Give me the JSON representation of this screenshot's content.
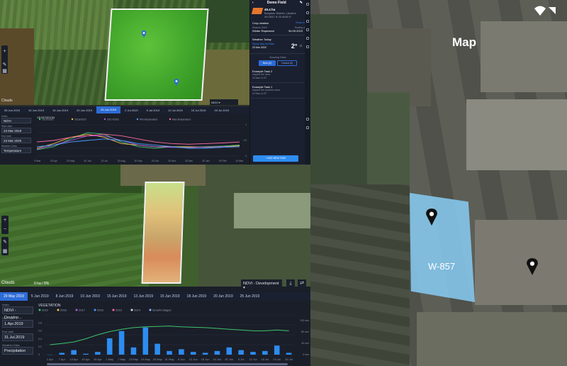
{
  "panel1": {
    "clouds_label": "Clouds",
    "layer_select": "NDVI",
    "dates": [
      "05 Jun 2019",
      "10 Jun 2019",
      "15 Jun 2019",
      "20 Jun 2019",
      "25 Jun 2019",
      "2 Jul 2019",
      "5 Jul 2019",
      "10 Jul 2019",
      "15 Jul 2019",
      "20 Jul 2019"
    ],
    "active_date_index": 4,
    "tools": [
      {
        "label": "Index",
        "value": "NDVI"
      },
      {
        "label": "Start date",
        "value": "23 Mar 2019"
      },
      {
        "label": "End date",
        "value": "23 Mar 2020"
      },
      {
        "label": "Weather Data",
        "value": "Temperature"
      }
    ],
    "vegetation_title": "VEGETATION",
    "chart_data": {
      "type": "line",
      "x": [
        "20 Mar",
        "20 Apr",
        "20 May",
        "20 Jun",
        "20 Jul",
        "20 Aug",
        "20 Sep",
        "20 Oct",
        "20 Nov",
        "20 Dec",
        "20 Jan",
        "20 Feb",
        "20 Mar"
      ],
      "series": [
        {
          "name": "2019/2020",
          "values": [
            0.2,
            0.3,
            0.55,
            0.75,
            0.7,
            0.45,
            0.3,
            0.25,
            0.3,
            0.28,
            0.3,
            0.32,
            0.35
          ]
        },
        {
          "name": "2018/2019",
          "values": [
            0.25,
            0.4,
            0.6,
            0.7,
            0.6,
            0.4,
            0.35,
            0.3,
            0.3,
            0.3,
            0.28,
            0.3,
            0.33
          ]
        },
        {
          "name": "2017/2018",
          "values": [
            0.22,
            0.35,
            0.5,
            0.65,
            0.65,
            0.5,
            0.35,
            0.3,
            0.28,
            0.27,
            0.29,
            0.3,
            0.3
          ]
        },
        {
          "name": "Min temperature",
          "values": [
            0.3,
            0.35,
            0.45,
            0.5,
            0.55,
            0.5,
            0.4,
            0.35,
            0.3,
            0.25,
            0.25,
            0.28,
            0.3
          ]
        },
        {
          "name": "Max temperature",
          "values": [
            0.45,
            0.5,
            0.6,
            0.65,
            0.7,
            0.65,
            0.55,
            0.45,
            0.4,
            0.38,
            0.4,
            0.42,
            0.45
          ]
        }
      ],
      "ylim": [
        0,
        1
      ]
    }
  },
  "sidebar": {
    "title": "Demo Field",
    "area": "40.4 ha",
    "location": "Boryslav District, Ukraine",
    "coords": "49.2547 N 23.4692 E",
    "crop_rotation_label": "Crop rotation",
    "show_more": "Show more",
    "season_label": "Season 2019",
    "season_value": "Winter Rapeseed",
    "sowing_label": "Sowing date",
    "sowing_value": "30.09.2019",
    "weather_label": "Weather Today",
    "weather_desc": "Sunny Day No Rain",
    "weather_date": "23 Mar 2020",
    "temperature": "2°",
    "scouting_label": "Scouting Tasks",
    "tab_new": "New (2)",
    "tab_closed": "Closed (0)",
    "tasks": [
      {
        "title": "Example Task 2",
        "desc": "Inspect the area",
        "date": "23 Mar 11:57"
      },
      {
        "title": "Example Task 1",
        "desc": "Inspect the problem area",
        "date": "23 Mar 11:57"
      }
    ],
    "new_task": "+ ADD NEW TASK"
  },
  "panel2": {
    "clouds_label": "Clouds",
    "cloud_pct": "0 ha / 0%",
    "layer_select": "NDVI - Development",
    "dates": [
      "29 May 2019",
      "5 Jun 2019",
      "8 Jun 2019",
      "10 Jun 2019",
      "15 Jun 2019",
      "13 Jun 2019",
      "15 Jun 2019",
      "18 Jun 2019",
      "20 Jun 2019",
      "25 Jun 2019"
    ],
    "active_date_index": 0,
    "tools": [
      {
        "label": "Index",
        "value": "NDVI - Develop..."
      },
      {
        "label": "Start date",
        "value": "1.Apr.2019"
      },
      {
        "label": "End date",
        "value": "31.Jul.2019"
      },
      {
        "label": "Weather Data",
        "value": "Precipitation"
      }
    ],
    "vegetation_title": "VEGETATION",
    "legend": [
      "2019",
      "2018",
      "2017",
      "2016",
      "2015",
      "2014",
      "Growth Stages"
    ],
    "chart_data": {
      "type": "bar",
      "categories": [
        "1 Apr",
        "7 Apr",
        "13 Apr",
        "19 Apr",
        "25 Apr",
        "1 May",
        "7 May",
        "13 May",
        "19 May",
        "25 May",
        "31 May",
        "6 Jun",
        "12 Jun",
        "18 Jun",
        "24 Jun",
        "30 Jun",
        "6 Jul",
        "12 Jul",
        "18 Jul",
        "24 Jul",
        "30 Jul"
      ],
      "precip_values": [
        0,
        2,
        5,
        1,
        3,
        18,
        26,
        8,
        30,
        12,
        4,
        6,
        3,
        2,
        4,
        8,
        5,
        3,
        4,
        10,
        2
      ],
      "ndvi_line": [
        0.25,
        0.28,
        0.32,
        0.4,
        0.5,
        0.58,
        0.64,
        0.68,
        0.7,
        0.71,
        0.72,
        0.7,
        0.69,
        0.68,
        0.66,
        0.64,
        0.62,
        0.6,
        0.6,
        0.62,
        0.6
      ],
      "ylim_left": [
        0,
        1
      ],
      "ylim_right": [
        0,
        140
      ]
    }
  },
  "panel3": {
    "title": "Map",
    "field_label": "W-857"
  }
}
